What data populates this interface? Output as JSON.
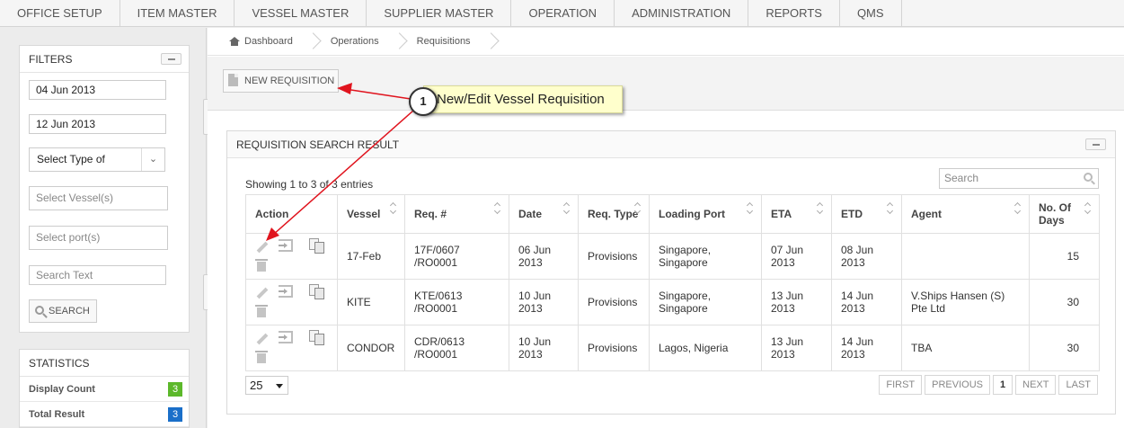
{
  "nav": [
    "OFFICE SETUP",
    "ITEM MASTER",
    "VESSEL MASTER",
    "SUPPLIER MASTER",
    "OPERATION",
    "ADMINISTRATION",
    "REPORTS",
    "QMS"
  ],
  "filters": {
    "title": "FILTERS",
    "date_from": "04 Jun 2013",
    "date_to": "12 Jun 2013",
    "type_select": "Select Type of",
    "vessel_placeholder": "Select Vessel(s)",
    "port_placeholder": "Select port(s)",
    "search_text_placeholder": "Search Text",
    "search_button": "SEARCH"
  },
  "statistics": {
    "title": "STATISTICS",
    "rows": [
      {
        "label": "Display Count",
        "value": "3",
        "color": "#5cb82a"
      },
      {
        "label": "Total Result",
        "value": "3",
        "color": "#1a6fc9"
      }
    ]
  },
  "breadcrumb": [
    "Dashboard",
    "Operations",
    "Requisitions"
  ],
  "toolbar": {
    "new_requisition": "NEW REQUISITION"
  },
  "annotation": {
    "step": "1",
    "text": "New/Edit  Vessel Requisition",
    "arrow_color": "#e0141e"
  },
  "results": {
    "title": "REQUISITION SEARCH RESULT",
    "showing": "Showing 1 to 3 of 3 entries",
    "search_placeholder": "Search",
    "columns": [
      "Action",
      "Vessel",
      "Req. #",
      "Date",
      "Req. Type",
      "Loading Port",
      "ETA",
      "ETD",
      "Agent",
      "No. Of Days"
    ],
    "rows": [
      {
        "vessel": "17-Feb",
        "req": "17F/0607 /RO0001",
        "date": "06 Jun 2013",
        "type": "Provisions",
        "port": "Singapore, Singapore",
        "eta": "07 Jun 2013",
        "etd": "08 Jun 2013",
        "agent": "",
        "days": "15"
      },
      {
        "vessel": "KITE",
        "req": "KTE/0613 /RO0001",
        "date": "10 Jun 2013",
        "type": "Provisions",
        "port": "Singapore, Singapore",
        "eta": "13 Jun 2013",
        "etd": "14 Jun 2013",
        "agent": "V.Ships Hansen (S) Pte Ltd",
        "days": "30"
      },
      {
        "vessel": "CONDOR",
        "req": "CDR/0613 /RO0001",
        "date": "10 Jun 2013",
        "type": "Provisions",
        "port": "Lagos, Nigeria",
        "eta": "13 Jun 2013",
        "etd": "14 Jun 2013",
        "agent": "TBA",
        "days": "30"
      }
    ],
    "page_size": "25",
    "pager": [
      "FIRST",
      "PREVIOUS",
      "1",
      "NEXT",
      "LAST"
    ]
  }
}
